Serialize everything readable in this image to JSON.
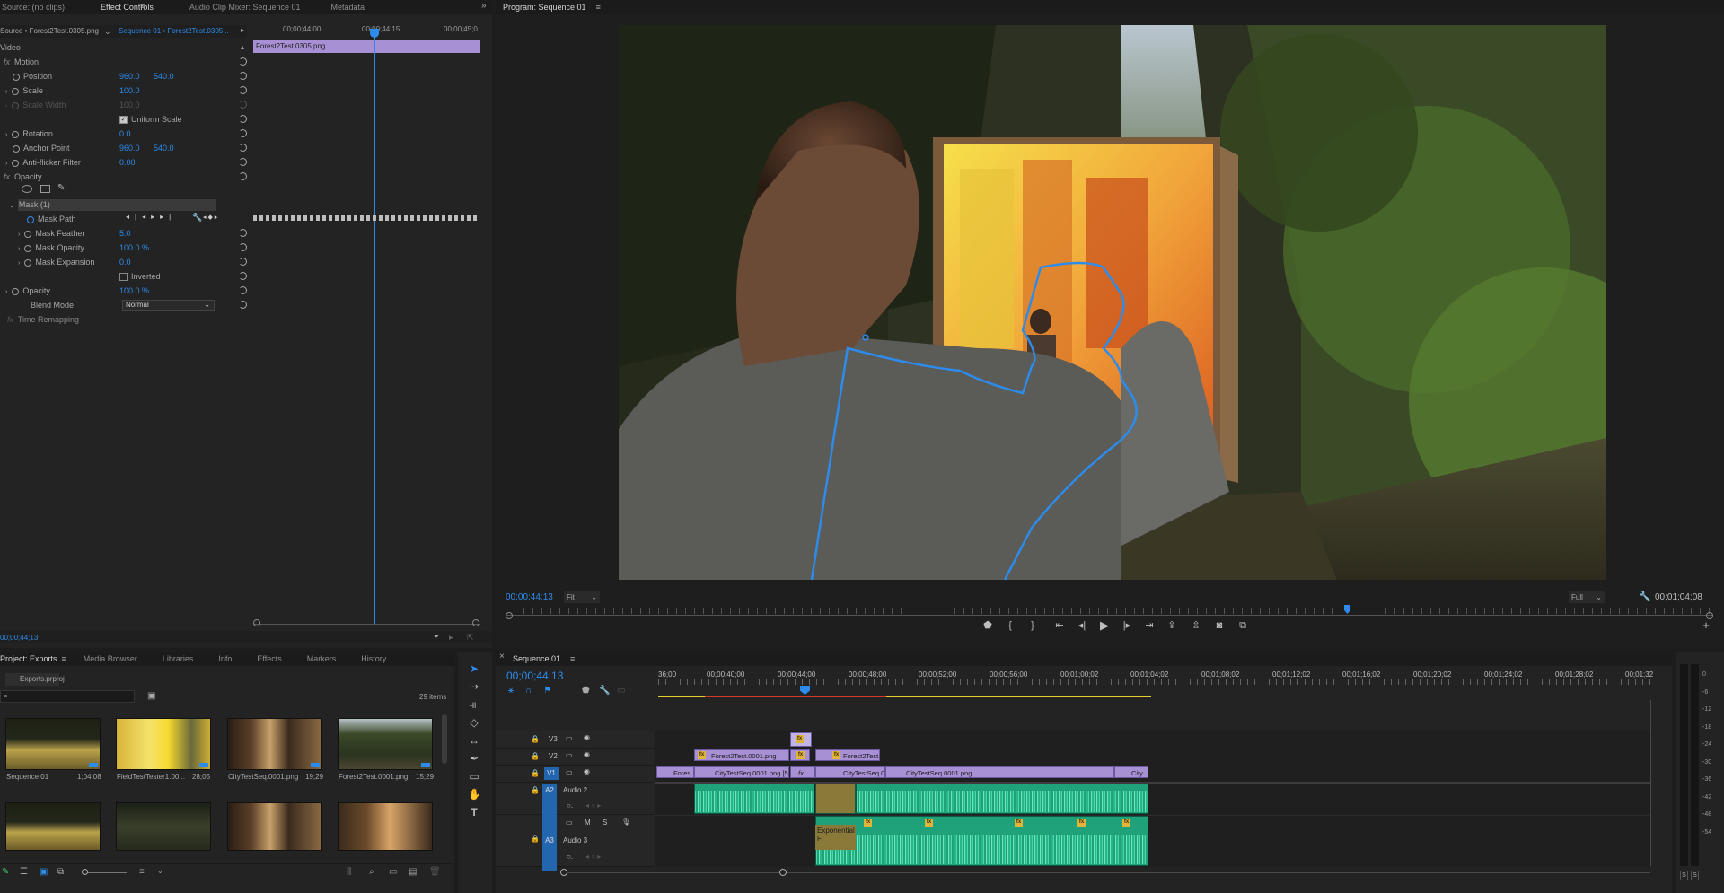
{
  "source_tab": "Source: (no clips)",
  "top_tabs": [
    "Effect Controls",
    "Audio Clip Mixer: Sequence 01",
    "Metadata"
  ],
  "program_title": "Program: Sequence 01",
  "ec": {
    "source_label": "Source • Forest2Test.0305.png",
    "sequence_label": "Sequence 01 • Forest2Test.0305...",
    "ruler": [
      "00;00;44;00",
      "00;00;44;15",
      "00;00;45;0"
    ],
    "clip_label": "Forest2Test.0305.png",
    "video_header": "Video",
    "motion": "Motion",
    "position": "Position",
    "pos_x": "960.0",
    "pos_y": "540.0",
    "scale": "Scale",
    "scale_val": "100.0",
    "scale_width": "Scale Width",
    "scale_width_val": "100.0",
    "uniform_scale": "Uniform Scale",
    "rotation": "Rotation",
    "rotation_val": "0.0",
    "anchor": "Anchor Point",
    "anchor_x": "960.0",
    "anchor_y": "540.0",
    "antiflicker": "Anti-flicker Filter",
    "antiflicker_val": "0.00",
    "opacity_group": "Opacity",
    "mask": "Mask (1)",
    "mask_path": "Mask Path",
    "mask_feather": "Mask Feather",
    "mask_feather_val": "5.0",
    "mask_opacity": "Mask Opacity",
    "mask_opacity_val": "100.0 %",
    "mask_expansion": "Mask Expansion",
    "mask_expansion_val": "0.0",
    "inverted": "Inverted",
    "opacity": "Opacity",
    "opacity_val": "100.0 %",
    "blend_mode": "Blend Mode",
    "blend_mode_val": "Normal",
    "time_remap": "Time Remapping",
    "timecode": "00;00;44;13"
  },
  "program": {
    "timecode": "00;00;44;13",
    "fit": "Fit",
    "quality": "Full",
    "duration": "00;01;04;08"
  },
  "project": {
    "tabs": [
      "Project: Exports",
      "Media Browser",
      "Libraries",
      "Info",
      "Effects",
      "Markers",
      "History"
    ],
    "file": "Exports.prproj",
    "count": "29 items",
    "items": [
      {
        "name": "Sequence 01",
        "dur": "1;04;08"
      },
      {
        "name": "FieldTestTester1.00...",
        "dur": "28;05"
      },
      {
        "name": "CityTestSeq.0001.png",
        "dur": "19;29"
      },
      {
        "name": "Forest2Test.0001.png",
        "dur": "15;29"
      }
    ]
  },
  "timeline": {
    "tab": "Sequence 01",
    "timecode": "00;00;44;13",
    "ticks": [
      "36;00",
      "00;00;40;00",
      "00;00;44;00",
      "00;00;48;00",
      "00;00;52;00",
      "00;00;56;00",
      "00;01;00;02",
      "00;01;04;02",
      "00;01;08;02",
      "00;01;12;02",
      "00;01;16;02",
      "00;01;20;02",
      "00;01;24;02",
      "00;01;28;02",
      "00;01;32"
    ],
    "tracks": {
      "v3": "V3",
      "v2": "V2",
      "v1": "V1",
      "a2": "A2",
      "a2name": "Audio 2",
      "a3": "A3",
      "a3name": "Audio 3"
    },
    "clips": {
      "v2a": "Forest2Test.0001.png",
      "v2b": "Forest2Test.0",
      "v1a": "Fores",
      "v1b": "CityTestSeq.0001.png [50",
      "v1c": "CityTestSeq.00",
      "v1d": "CityTestSeq.0001.png",
      "v1e": "City",
      "transition": "Exponential F",
      "fx": "fx"
    },
    "meter_scale": [
      "0",
      "-6",
      "-12",
      "-18",
      "-24",
      "-30",
      "-36",
      "-42",
      "-48",
      "-54"
    ],
    "meter_solo": [
      "S",
      "S"
    ]
  },
  "colors": {
    "accent": "#2d8ceb",
    "clip_video": "#a890d4",
    "clip_audio": "#1fa27a"
  }
}
